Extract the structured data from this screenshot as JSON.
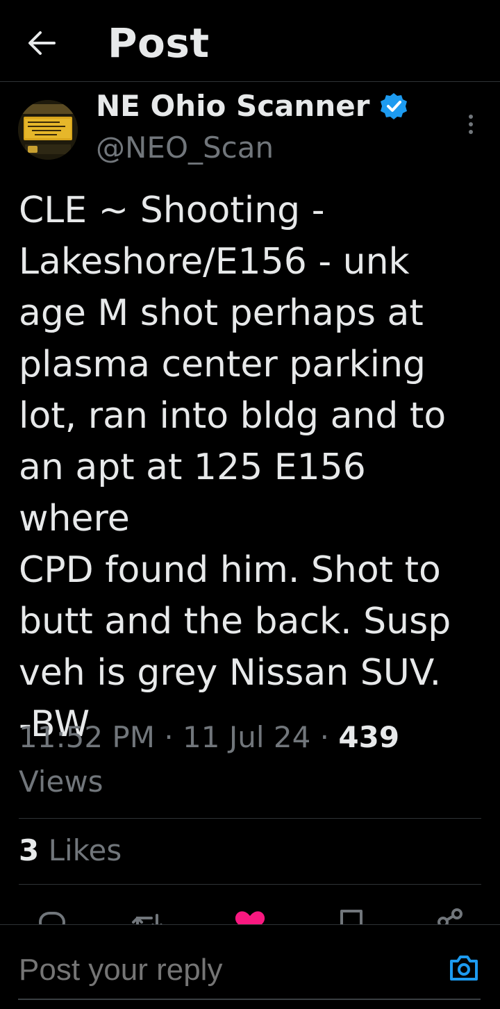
{
  "header": {
    "title": "Post"
  },
  "author": {
    "name": "NE Ohio Scanner",
    "handle": "@NEO_Scan"
  },
  "post": {
    "text": "CLE ~ Shooting -\nLakeshore/E156 - unk\nage M shot perhaps at\nplasma center parking\nlot, ran into bldg and to\nan apt at 125 E156 where\nCPD found him.  Shot to\nbutt and the back.  Susp\nveh is grey Nissan SUV.\n-BW",
    "time": "11:52 PM",
    "date": "11 Jul 24",
    "views_count": "439",
    "views_label": "Views",
    "likes_count": "3",
    "likes_label": "Likes"
  },
  "reply": {
    "placeholder": "Post your reply"
  },
  "colors": {
    "verified": "#1d9bf0",
    "like": "#f91880",
    "muted": "#71767b"
  }
}
